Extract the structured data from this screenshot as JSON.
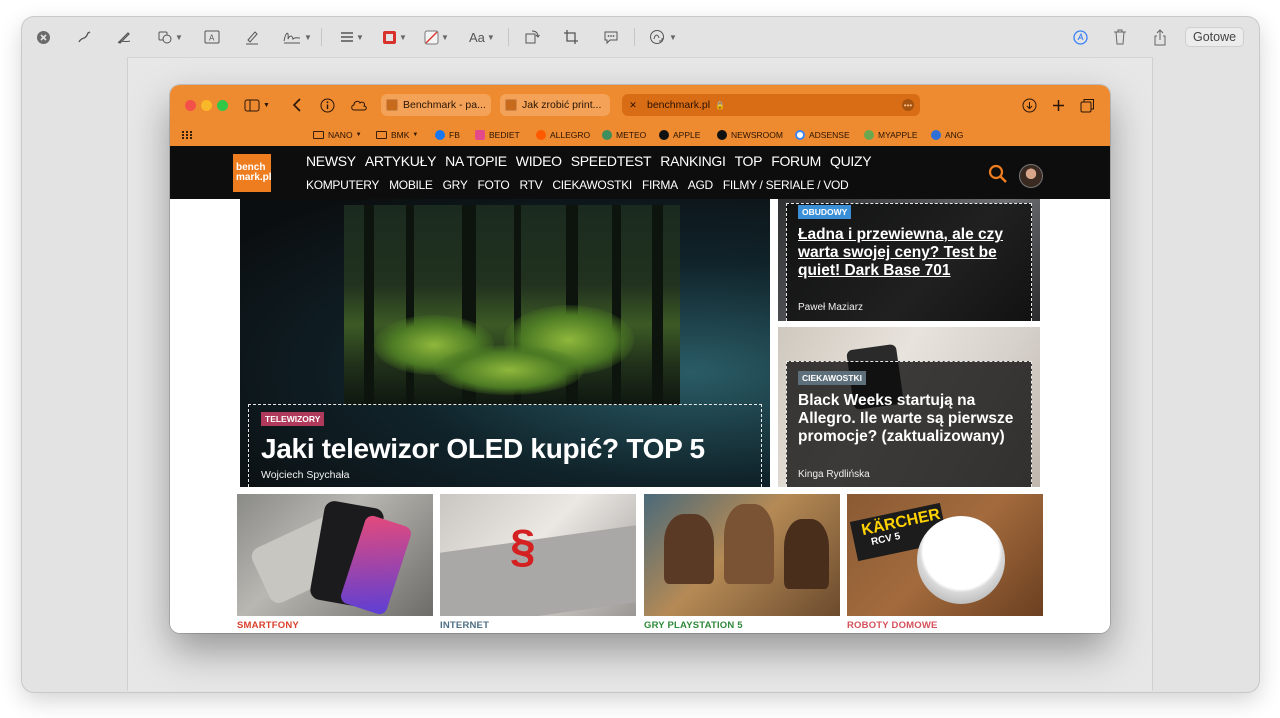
{
  "markup_toolbar": {
    "done_label": "Gotowe",
    "text_style_label": "Aa",
    "icons": [
      "close-icon",
      "sketch-icon",
      "draw-icon",
      "shapes-icon",
      "text-box-icon",
      "highlight-icon",
      "sign-icon",
      "shape-style-icon",
      "border-color-icon",
      "fill-color-icon",
      "text-style-icon",
      "rotate-icon",
      "crop-icon",
      "annotate-icon",
      "accessibility-icon",
      "markup-icon",
      "trash-icon",
      "share-icon"
    ]
  },
  "browser": {
    "tabs": [
      {
        "title": "Benchmark - pa..."
      },
      {
        "title": "Jak zrobić print..."
      },
      {
        "title": "benchmark.pl"
      }
    ],
    "bookmarks": [
      {
        "label": "NANO"
      },
      {
        "label": "BMK"
      },
      {
        "label": "FB"
      },
      {
        "label": "BEDIET"
      },
      {
        "label": "ALLEGRO"
      },
      {
        "label": "METEO"
      },
      {
        "label": "APPLE"
      },
      {
        "label": "NEWSROOM"
      },
      {
        "label": "ADSENSE"
      },
      {
        "label": "MYAPPLE"
      },
      {
        "label": "ANG"
      }
    ]
  },
  "site": {
    "logo_text": "bench mark.pl",
    "nav_primary": [
      "NEWSY",
      "ARTYKUŁY",
      "NA TOPIE",
      "WIDEO",
      "SPEEDTEST",
      "RANKINGI",
      "TOP",
      "FORUM",
      "QUIZY"
    ],
    "nav_secondary": [
      "KOMPUTERY",
      "MOBILE",
      "GRY",
      "FOTO",
      "RTV",
      "CIEKAWOSTKI",
      "FIRMA",
      "AGD",
      "FILMY / SERIALE / VOD"
    ],
    "hero": {
      "category": "TELEWIZORY",
      "title": "Jaki telewizor OLED kupić? TOP 5",
      "author": "Wojciech Spychała"
    },
    "side_articles": [
      {
        "category": "OBUDOWY",
        "title": "Ładna i przewiewna, ale czy warta swojej ceny? Test be quiet! Dark Base 701",
        "author": "Paweł Maziarz"
      },
      {
        "category": "CIEKAWOSTKI",
        "title": "Black Weeks startują na Allegro. Ile warte są pierwsze promocje? (zaktualizowany)",
        "author": "Kinga Rydlińska"
      }
    ],
    "thumbnails": [
      {
        "category": "SMARTFONY"
      },
      {
        "category": "INTERNET"
      },
      {
        "category": "GRY PLAYSTATION 5"
      },
      {
        "category": "ROBOTY DOMOWE",
        "image_text": "KÄRCHER",
        "image_subtext": "RCV 5"
      }
    ]
  },
  "colors": {
    "safari_orange": "#ee8a2f",
    "brand_orange": "#ee7d1f",
    "cat_smartfony": "#d9412b",
    "cat_internet": "#4e6e86",
    "cat_gry": "#2f8a3a",
    "cat_roboty": "#d4515b",
    "badge_telewizory": "#b03a5b",
    "badge_obudowy": "#3b8fd6",
    "badge_ciekawostki": "#5d6f7a"
  }
}
